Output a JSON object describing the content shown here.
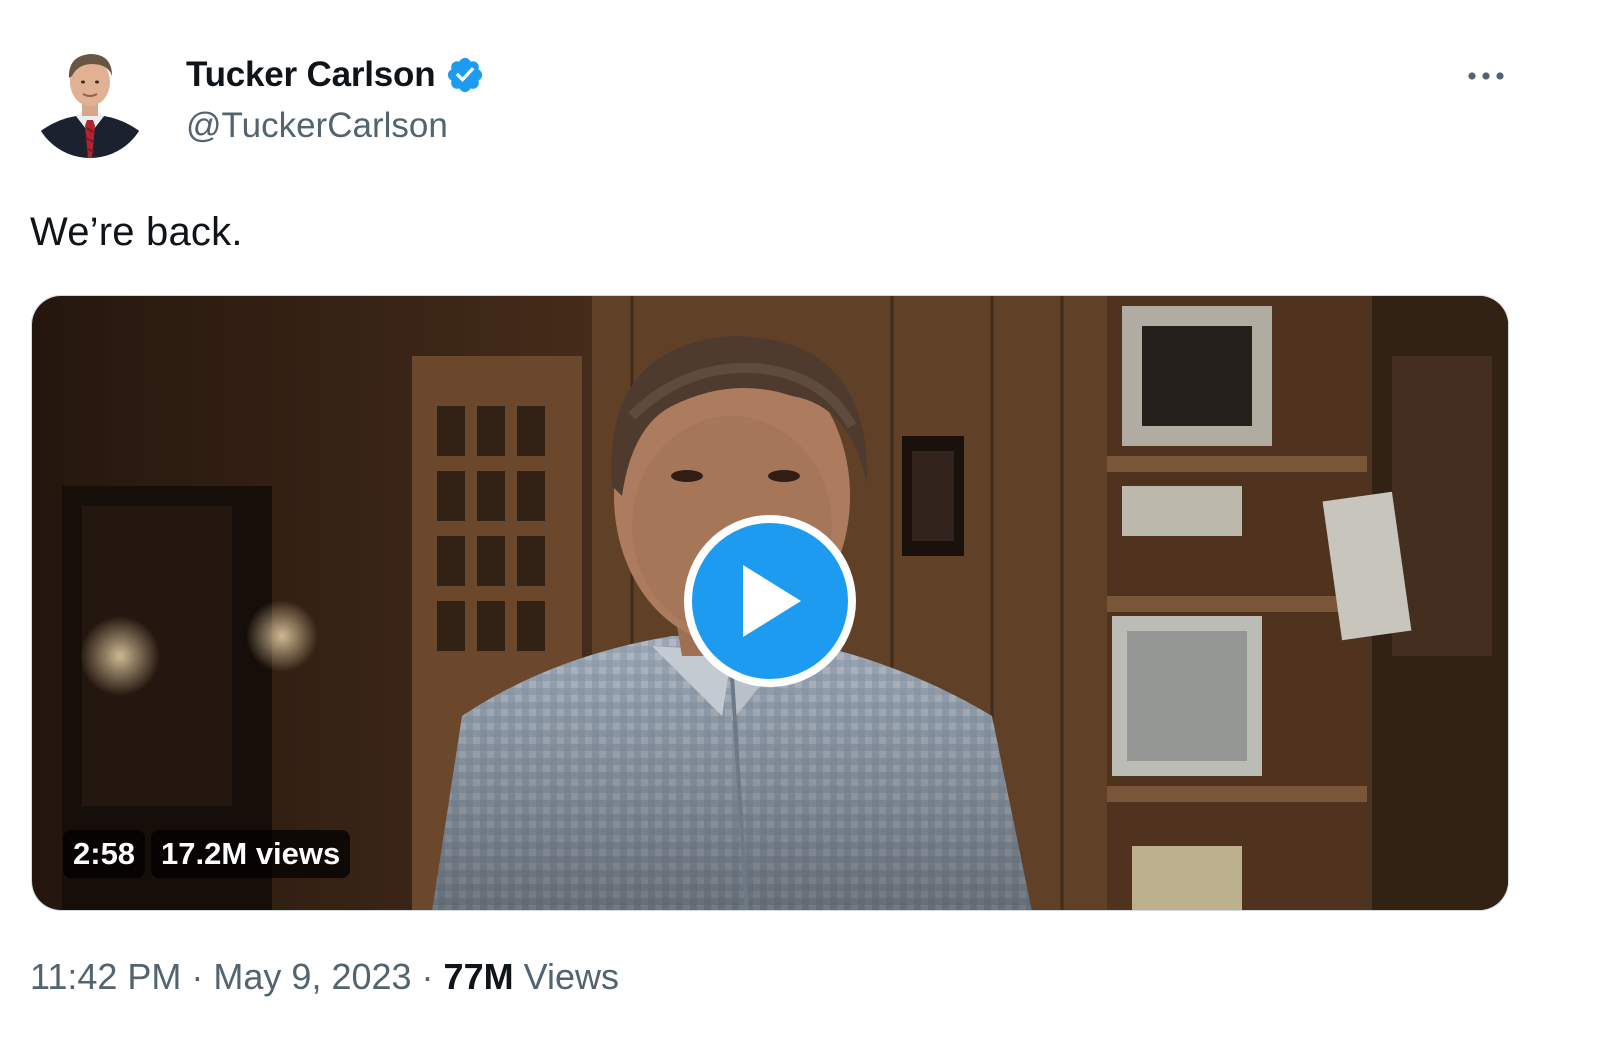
{
  "author": {
    "display_name": "Tucker Carlson",
    "handle": "@TuckerCarlson",
    "verified": true,
    "avatar_icon": "avatar-portrait"
  },
  "menu": {
    "icon": "more-horizontal-icon",
    "glyph": "•••"
  },
  "tweet": {
    "text": "We’re back."
  },
  "media": {
    "type": "video",
    "duration": "2:58",
    "views": "17.2M views",
    "play_icon": "play-icon"
  },
  "meta": {
    "time": "11:42 PM",
    "separator": "·",
    "date": "May 9, 2023",
    "views_count": "77M",
    "views_label": "Views"
  },
  "colors": {
    "accent": "#1d9bf0",
    "text_primary": "#0f1419",
    "text_secondary": "#536471"
  }
}
